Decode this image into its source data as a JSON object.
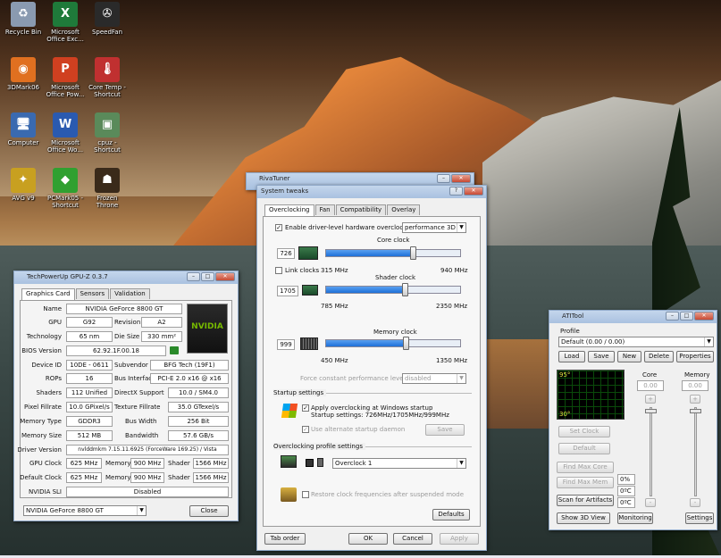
{
  "desktop_icons": [
    {
      "label": "Recycle Bin",
      "icon": "recycle-bin-icon",
      "color": "#8a9ab0"
    },
    {
      "label": "Microsoft Office Exc...",
      "icon": "excel-icon",
      "color": "#1f7a3a"
    },
    {
      "label": "SpeedFan",
      "icon": "fan-icon",
      "color": "#2a2a2a"
    },
    {
      "label": "3DMark06",
      "icon": "3dmark-icon",
      "color": "#e07020"
    },
    {
      "label": "Microsoft Office Pow...",
      "icon": "powerpoint-icon",
      "color": "#d04020"
    },
    {
      "label": "Core Temp - Shortcut",
      "icon": "thermometer-icon",
      "color": "#c03030"
    },
    {
      "label": "Computer",
      "icon": "computer-icon",
      "color": "#3a6ab0"
    },
    {
      "label": "Microsoft Office Wo...",
      "icon": "word-icon",
      "color": "#2a5ab0"
    },
    {
      "label": "cpuz - Shortcut",
      "icon": "cpu-icon",
      "color": "#5a8a5a"
    },
    {
      "label": "AVG v9",
      "icon": "avg-icon",
      "color": "#c8a020"
    },
    {
      "label": "PCMark05 - Shortcut",
      "icon": "pcmark-icon",
      "color": "#30a030"
    },
    {
      "label": "Frozen Throne",
      "icon": "warcraft-icon",
      "color": "#3a2a1a"
    }
  ],
  "gpuz": {
    "title": "TechPowerUp GPU-Z 0.3.7",
    "tabs": [
      "Graphics Card",
      "Sensors",
      "Validation"
    ],
    "logo_text": "NVIDIA",
    "name_label": "Name",
    "name": "NVIDIA GeForce 8800 GT",
    "gpu_label": "GPU",
    "gpu": "G92",
    "revision_label": "Revision",
    "revision": "A2",
    "tech_label": "Technology",
    "tech": "65 nm",
    "diesize_label": "Die Size",
    "diesize": "330 mm²",
    "bios_label": "BIOS Version",
    "bios": "62.92.1F.00.18",
    "devid_label": "Device ID",
    "devid": "10DE - 0611",
    "subvendor_label": "Subvendor",
    "subvendor": "BFG Tech (19F1)",
    "rops_label": "ROPs",
    "rops": "16",
    "bus_label": "Bus Interface",
    "bus": "PCI-E 2.0 x16 @ x16",
    "shaders_label": "Shaders",
    "shaders": "112 Unified",
    "dx_label": "DirectX Support",
    "dx": "10.0 / SM4.0",
    "pixel_label": "Pixel Fillrate",
    "pixel": "10.0 GPixel/s",
    "texture_label": "Texture Fillrate",
    "texture": "35.0 GTexel/s",
    "memtype_label": "Memory Type",
    "memtype": "GDDR3",
    "buswidth_label": "Bus Width",
    "buswidth": "256 Bit",
    "memsize_label": "Memory Size",
    "memsize": "512 MB",
    "bandwidth_label": "Bandwidth",
    "bandwidth": "57.6 GB/s",
    "driver_label": "Driver Version",
    "driver": "nvlddmkm 7.15.11.6925 (ForceWare 169.25) / Vista",
    "gpuclock_label": "GPU Clock",
    "gpuclock": "625 MHz",
    "memory_label": "Memory",
    "gpumem": "900 MHz",
    "shader_label": "Shader",
    "gpushader": "1566 MHz",
    "defclock_label": "Default Clock",
    "defclock": "625 MHz",
    "defmem": "900 MHz",
    "defshader": "1566 MHz",
    "sli_label": "NVIDIA SLI",
    "sli": "Disabled",
    "selected_card": "NVIDIA GeForce 8800 GT",
    "close_label": "Close"
  },
  "rivatuner": {
    "title": "RivaTuner",
    "dialog_title": "System tweaks",
    "tabs": [
      "Overclocking",
      "Fan",
      "Compatibility",
      "Overlay"
    ],
    "enable_label": "Enable driver-level hardware overclocking",
    "enable_checked": "✓",
    "mode": "performance 3D",
    "core_label": "Core clock",
    "core_value": "726",
    "core_min": "315 MHz",
    "core_max": "940 MHz",
    "core_level": 0.65,
    "link_label": "Link clocks",
    "shader_label": "Shader clock",
    "shader_value": "1705",
    "shader_min": "785 MHz",
    "shader_max": "2350 MHz",
    "shader_level": 0.59,
    "memory_label": "Memory clock",
    "memory_value": "999",
    "memory_min": "450 MHz",
    "memory_max": "1350 MHz",
    "memory_level": 0.6,
    "force_label": "Force constant performance level",
    "force_value": "disabled",
    "startup_group": "Startup settings",
    "apply_label": "Apply overclocking at Windows startup",
    "startup_settings": "Startup settings: 726MHz/1705MHz/999MHz",
    "alt_daemon_label": "Use alternate startup daemon",
    "save_label": "Save",
    "profile_group": "Overclocking profile settings",
    "profile": "Overclock 1",
    "restore_label": "Restore clock frequencies after suspended mode",
    "defaults_label": "Defaults",
    "taborder_label": "Tab order",
    "ok_label": "OK",
    "cancel_label": "Cancel",
    "applybtn_label": "Apply"
  },
  "atitool": {
    "title": "ATITool",
    "profile_label": "Profile",
    "profile_value": "Default (0.00 / 0.00)",
    "load_label": "Load",
    "save_label": "Save",
    "new_label": "New",
    "delete_label": "Delete",
    "properties_label": "Properties",
    "temp_high": "95°",
    "temp_low": "30°",
    "core_label": "Core",
    "core_value": "0.00",
    "memory_label": "Memory",
    "memory_value": "0.00",
    "plus": "+",
    "minus": "-",
    "setclock_label": "Set Clock",
    "default_label": "Default",
    "findcore_label": "Find Max Core",
    "findmem_label": "Find Max Mem",
    "scan_label": "Scan for Artifacts",
    "show3d_label": "Show 3D View",
    "pct": "0%",
    "c1": "0ºC",
    "c2": "0ºC",
    "monitoring_label": "Monitoring",
    "settings_label": "Settings"
  }
}
